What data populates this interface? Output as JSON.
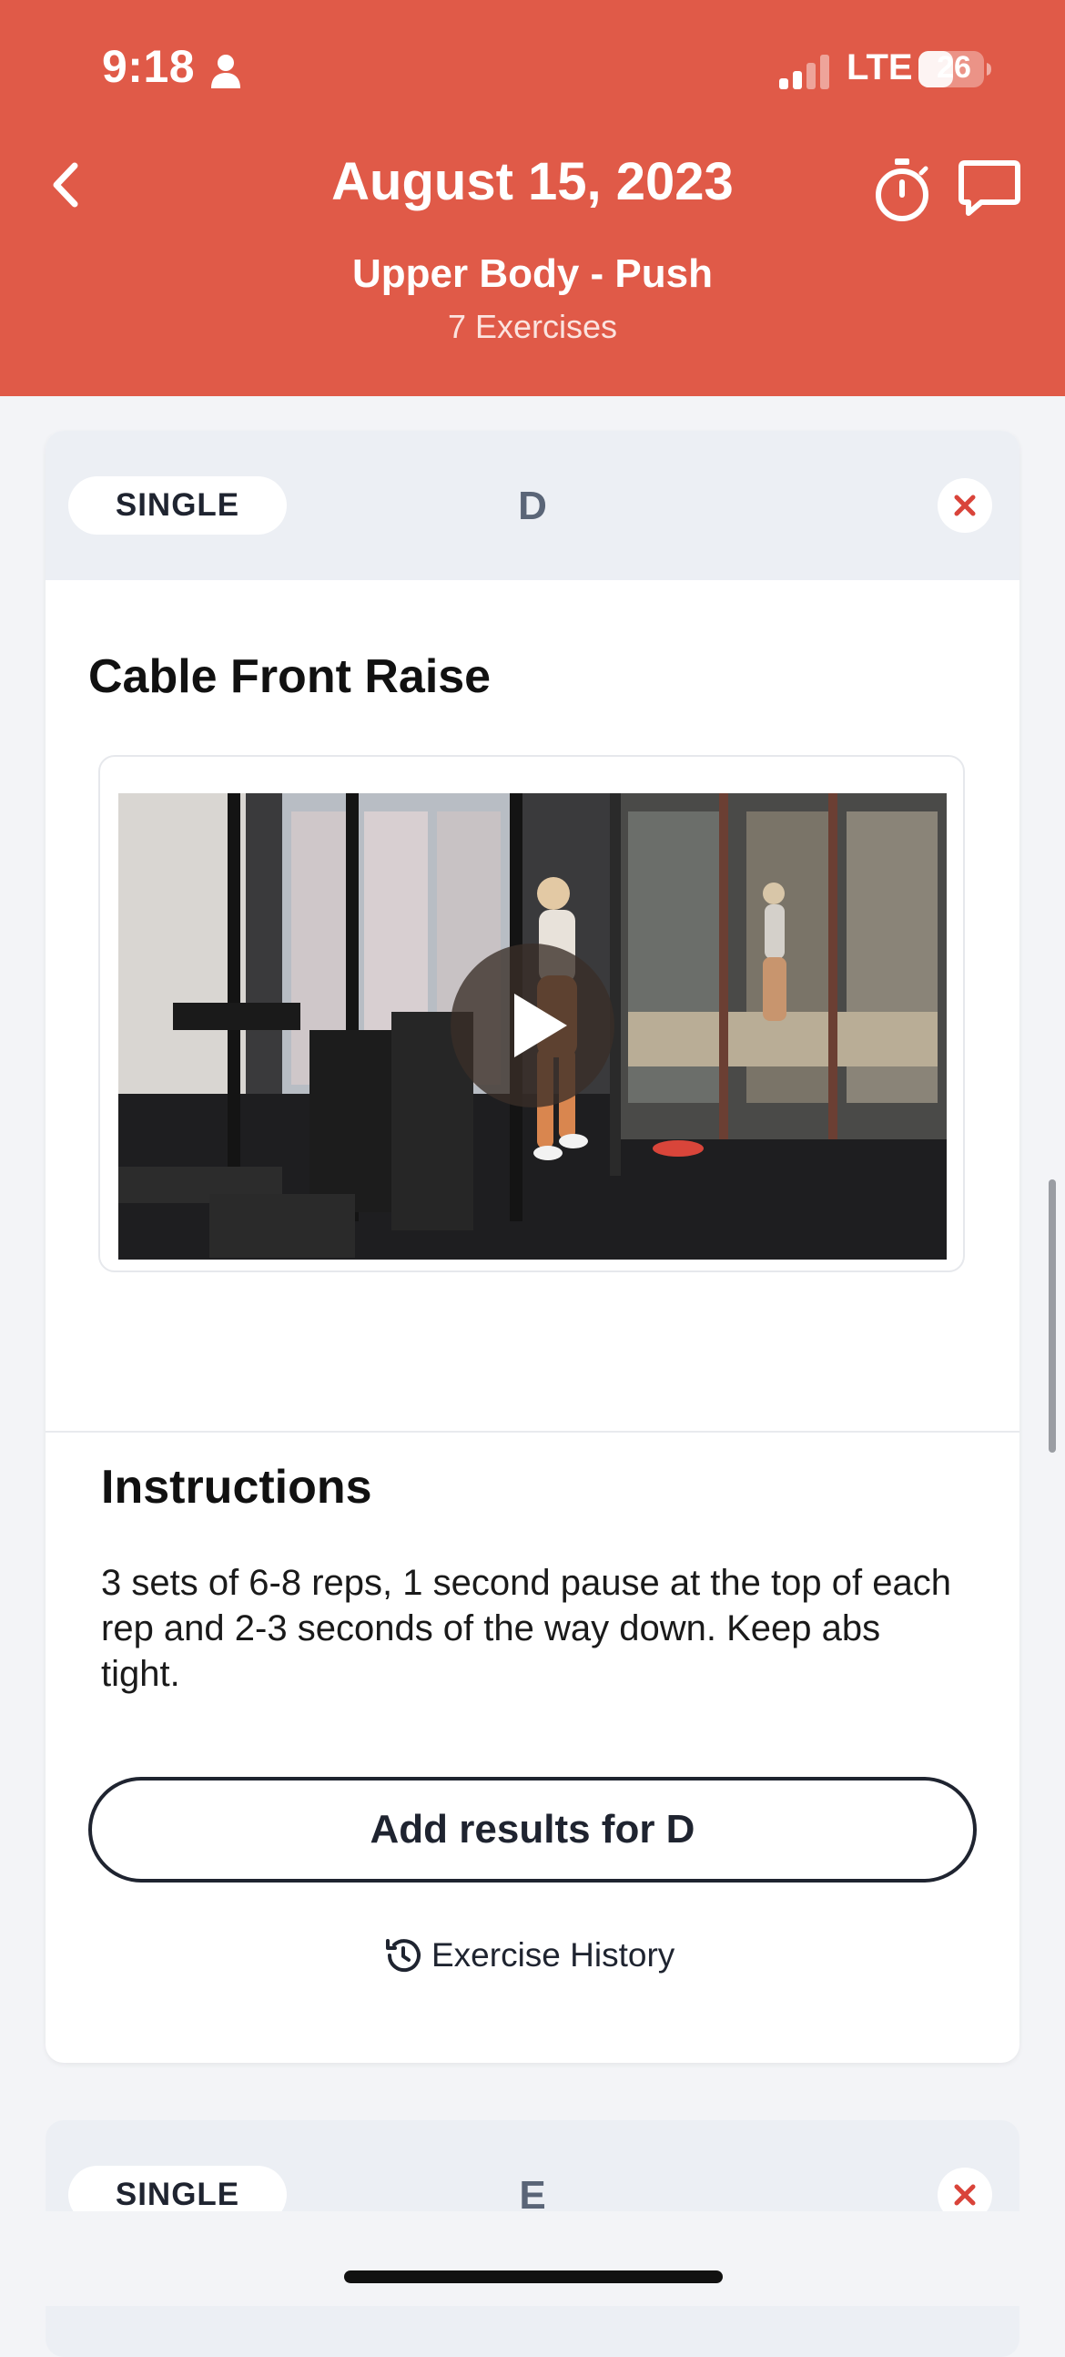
{
  "status_bar": {
    "time": "9:18",
    "network": "LTE",
    "battery_level": "26"
  },
  "header": {
    "title": "August 15, 2023",
    "workout_name": "Upper Body - Push",
    "exercise_count": "7 Exercises",
    "icons": {
      "back": "chevron-left-icon",
      "timer": "stopwatch-icon",
      "chat": "message-icon"
    }
  },
  "exercise_card": {
    "type_label": "SINGLE",
    "group_letter": "D",
    "exercise_name": "Cable Front Raise",
    "video": {
      "icon": "play-icon"
    },
    "instructions_title": "Instructions",
    "instructions_text": "3 sets of 6-8 reps, 1 second pause at the top of each rep and 2-3 seconds of the way down. Keep abs tight.",
    "add_results_label": "Add results for D",
    "history_label": "Exercise History"
  },
  "next_card": {
    "type_label": "SINGLE",
    "group_letter": "E"
  },
  "colors": {
    "header_bg": "#E05A48",
    "page_bg": "#F3F4F7",
    "card_header_bg": "#ECEFF4",
    "remove_icon": "#D9443A",
    "primary_text": "#1F2430"
  }
}
